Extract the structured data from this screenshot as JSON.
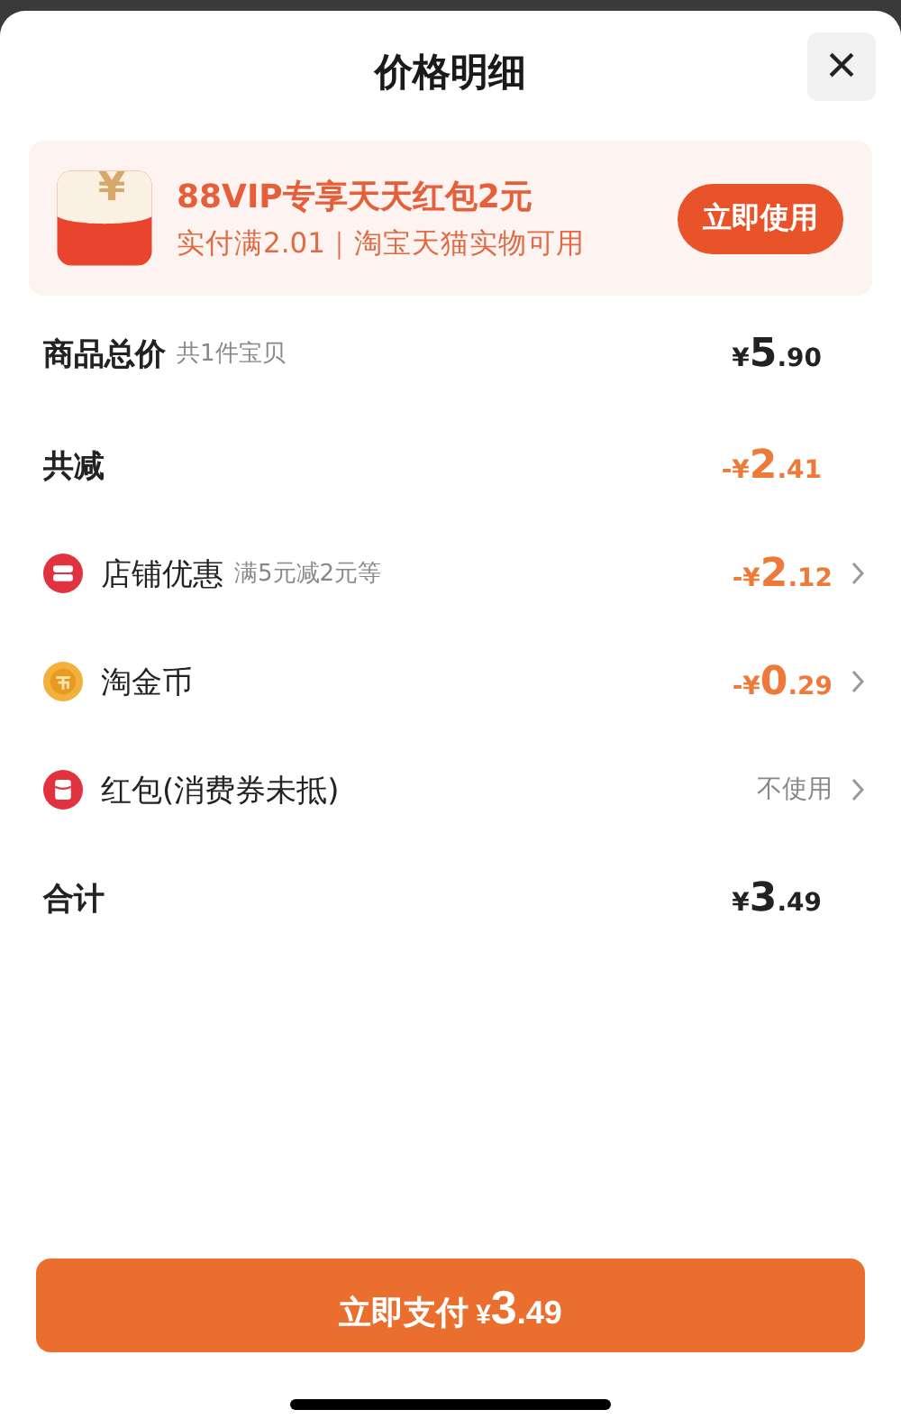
{
  "sheet": {
    "title": "价格明细",
    "close": "×"
  },
  "promo": {
    "title": "88VIP专享天天红包2元",
    "subtitle": "实付满2.01｜淘宝天猫实物可用",
    "button": "立即使用",
    "icon_symbol": "¥"
  },
  "rows": [
    {
      "kind": "summary",
      "label": "商品总价",
      "note": "共1件宝贝",
      "amount": {
        "prefix": "¥",
        "whole": "5",
        "fraction": ".90"
      },
      "highlighted": false,
      "has_arrow": false
    },
    {
      "kind": "summary",
      "label": "共减",
      "amount": {
        "prefix": "-¥",
        "whole": "2",
        "fraction": ".41"
      },
      "highlighted": true,
      "has_arrow": false
    },
    {
      "kind": "shop",
      "label": "店铺优惠",
      "note": "满5元减2元等",
      "amount": {
        "prefix": "-¥",
        "whole": "2",
        "fraction": ".12"
      },
      "highlighted": true,
      "has_arrow": true
    },
    {
      "kind": "coin",
      "label": "淘金币",
      "amount": {
        "prefix": "-¥",
        "whole": "0",
        "fraction": ".29"
      },
      "highlighted": true,
      "has_arrow": true
    },
    {
      "kind": "packet",
      "label": "红包(消费券未抵)",
      "value": "不使用",
      "highlighted": false,
      "has_arrow": true
    },
    {
      "kind": "summary",
      "label": "合计",
      "amount": {
        "prefix": "¥",
        "whole": "3",
        "fraction": ".49"
      },
      "highlighted": false,
      "has_arrow": false
    }
  ],
  "pay_button": {
    "label": "立即支付",
    "amount": {
      "prefix": "¥",
      "whole": "3",
      "fraction": ".49"
    }
  }
}
